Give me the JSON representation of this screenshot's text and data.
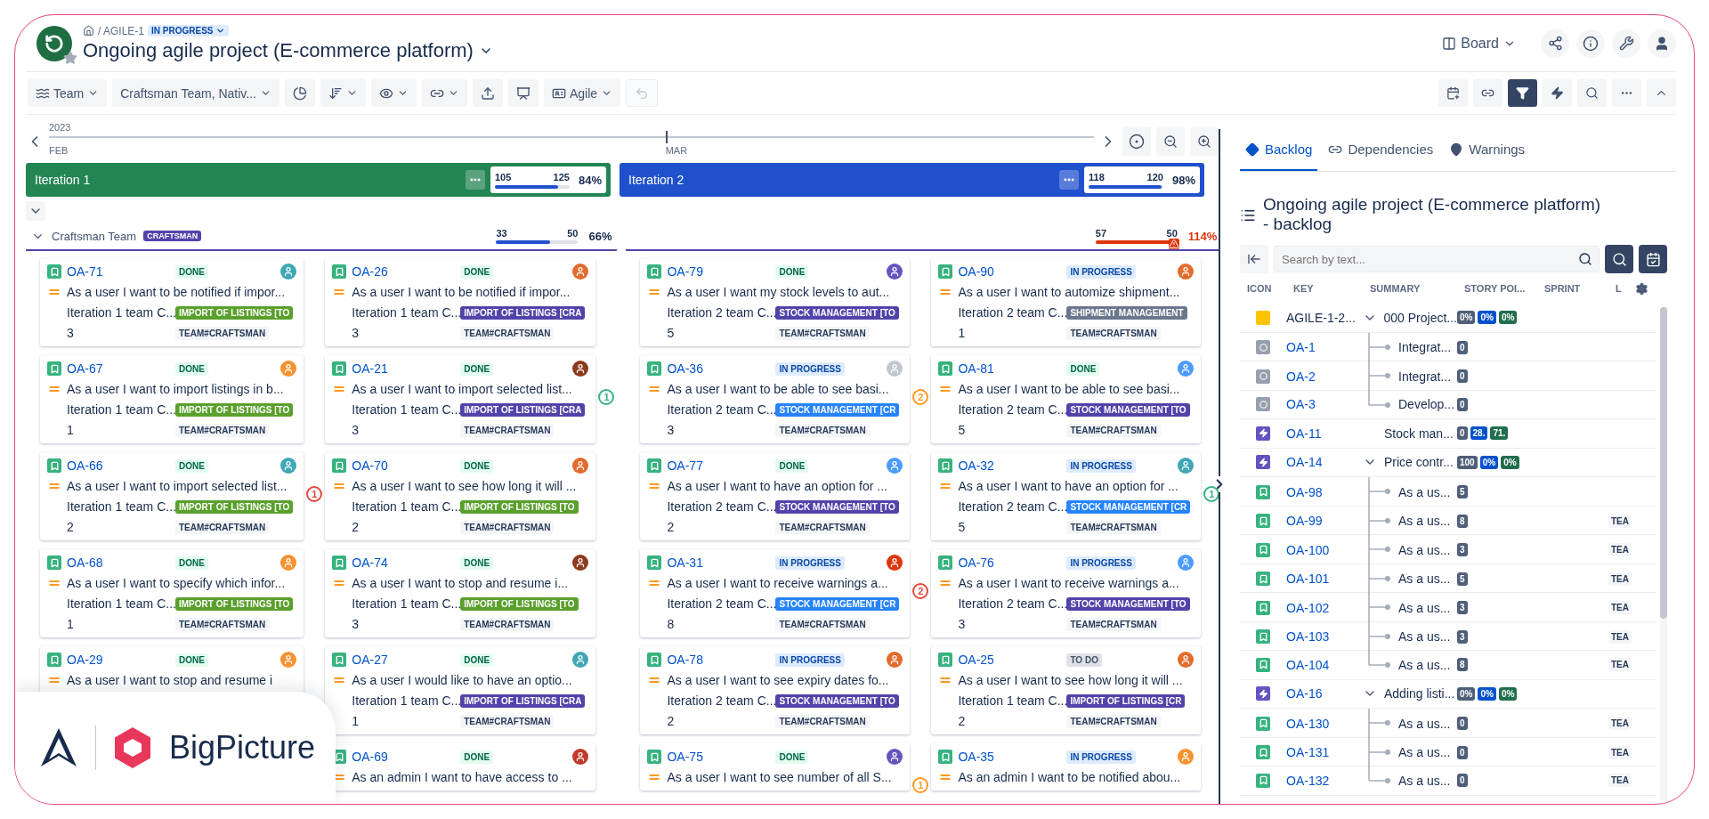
{
  "header": {
    "breadcrumb": "/ AGILE-1",
    "status": "IN PROGRESS",
    "title": "Ongoing agile project (E-commerce platform)",
    "view": "Board"
  },
  "toolbar": {
    "left": [
      {
        "kind": "dropdown",
        "label": "Team",
        "disabled": false
      },
      {
        "kind": "dropdown",
        "label": "Craftsman Team, Nativ...",
        "disabled": false
      },
      {
        "kind": "button",
        "disabled": false
      },
      {
        "kind": "dropdown",
        "disabled": false
      },
      {
        "kind": "dropdown",
        "disabled": false
      },
      {
        "kind": "dropdown",
        "disabled": false
      },
      {
        "kind": "button",
        "disabled": false
      },
      {
        "kind": "button",
        "disabled": false
      },
      {
        "kind": "dropdown",
        "label": "Agile",
        "disabled": false
      },
      {
        "kind": "button",
        "disabled": true
      }
    ],
    "right": [
      {
        "active": false
      },
      {
        "active": false
      },
      {
        "active": true
      },
      {
        "active": false
      },
      {
        "active": false
      },
      {
        "active": false
      },
      {
        "active": false
      }
    ]
  },
  "timeline": {
    "year": "2023",
    "months": [
      "FEB",
      "MAR"
    ]
  },
  "team": {
    "name": "Craftsman Team",
    "tag": "CRAFTSMAN"
  },
  "iterations": [
    {
      "name": "Iteration 1",
      "color": "#238553",
      "committed": "105",
      "capacity": "125",
      "percent": "84%",
      "level": 0.84,
      "team_load": {
        "committed": "33",
        "capacity": "50",
        "percent": "66%",
        "level": 0.66,
        "over": false
      },
      "columns": [
        [
          {
            "key": "OA-71",
            "status": {
              "text": "DONE",
              "kind": "done"
            },
            "avatar": {
              "color": "#3fa7b5"
            },
            "summary": "As a user I want to be notified if impor...",
            "iteration": "Iteration 1 team C...",
            "tag": {
              "text": "IMPORT OF LISTINGS [TO",
              "color": "#5aa02c"
            },
            "points": "3",
            "team": "TEAM#CRAFTSMAN"
          },
          {
            "key": "OA-67",
            "status": {
              "text": "DONE",
              "kind": "done"
            },
            "avatar": {
              "color": "#f79232"
            },
            "summary": "As a user I want to import listings in b...",
            "iteration": "Iteration 1 team C...",
            "tag": {
              "text": "IMPORT OF LISTINGS [TO",
              "color": "#5aa02c"
            },
            "points": "1",
            "team": "TEAM#CRAFTSMAN"
          },
          {
            "key": "OA-66",
            "status": {
              "text": "DONE",
              "kind": "done"
            },
            "avatar": {
              "color": "#3fa7b5"
            },
            "summary": "As a user I want to import selected list...",
            "iteration": "Iteration 1 team C...",
            "tag": {
              "text": "IMPORT OF LISTINGS [TO",
              "color": "#5aa02c"
            },
            "points": "2",
            "team": "TEAM#CRAFTSMAN",
            "count": {
              "text": "1",
              "color": "#e5493a"
            }
          },
          {
            "key": "OA-68",
            "status": {
              "text": "DONE",
              "kind": "done"
            },
            "avatar": {
              "color": "#f79232"
            },
            "summary": "As a user I want to specify which infor...",
            "iteration": "Iteration 1 team C...",
            "tag": {
              "text": "IMPORT OF LISTINGS [TO",
              "color": "#5aa02c"
            },
            "points": "1",
            "team": "TEAM#CRAFTSMAN"
          },
          {
            "key": "OA-29",
            "status": {
              "text": "DONE",
              "kind": "done"
            },
            "avatar": {
              "color": "#f79232"
            },
            "summary": "As a user I want to stop and resume i"
          }
        ],
        [
          {
            "key": "OA-26",
            "status": {
              "text": "DONE",
              "kind": "done"
            },
            "avatar": {
              "color": "#e36b2c"
            },
            "summary": "As a user I want to be notified if impor...",
            "iteration": "Iteration 1 team C...",
            "tag": {
              "text": "IMPORT OF LISTINGS [CRA",
              "color": "#5243aa"
            },
            "points": "3",
            "team": "TEAM#CRAFTSMAN"
          },
          {
            "key": "OA-21",
            "status": {
              "text": "DONE",
              "kind": "done"
            },
            "avatar": {
              "color": "#8c3b1e"
            },
            "summary": "As a user I want to import selected list...",
            "iteration": "Iteration 1 team C...",
            "tag": {
              "text": "IMPORT OF LISTINGS [CRA",
              "color": "#5243aa"
            },
            "points": "3",
            "team": "TEAM#CRAFTSMAN",
            "count": {
              "text": "1",
              "color": "#36b37e"
            }
          },
          {
            "key": "OA-70",
            "status": {
              "text": "DONE",
              "kind": "done"
            },
            "avatar": {
              "color": "#e36b2c"
            },
            "summary": "As a user I want to see how long it will ...",
            "iteration": "Iteration 1 team C...",
            "tag": {
              "text": "IMPORT OF LISTINGS [TO",
              "color": "#5aa02c"
            },
            "points": "2",
            "team": "TEAM#CRAFTSMAN"
          },
          {
            "key": "OA-74",
            "status": {
              "text": "DONE",
              "kind": "done"
            },
            "avatar": {
              "color": "#8c3b1e"
            },
            "summary": "As a user I want to stop and resume i...",
            "iteration": "Iteration 1 team C...",
            "tag": {
              "text": "IMPORT OF LISTINGS [TO",
              "color": "#5aa02c"
            },
            "points": "3",
            "team": "TEAM#CRAFTSMAN"
          },
          {
            "key": "OA-27",
            "status": {
              "text": "DONE",
              "kind": "done"
            },
            "avatar": {
              "color": "#3fa7b5"
            },
            "summary": "As a user I would like to have an optio...",
            "iteration": "Iteration 1 team C...",
            "tag": {
              "text": "IMPORT OF LISTINGS [CRA",
              "color": "#5243aa"
            },
            "points": "1",
            "team": "TEAM#CRAFTSMAN"
          },
          {
            "key": "OA-69",
            "status": {
              "text": "DONE",
              "kind": "done"
            },
            "avatar": {
              "color": "#c0392b"
            },
            "summary": "As an admin I want to have access to ..."
          }
        ]
      ]
    },
    {
      "name": "Iteration 2",
      "color": "#2051cc",
      "committed": "118",
      "capacity": "120",
      "percent": "98%",
      "level": 0.98,
      "team_load": {
        "committed": "57",
        "capacity": "50",
        "percent": "114%",
        "level": 1,
        "over": true
      },
      "columns": [
        [
          {
            "key": "OA-79",
            "status": {
              "text": "DONE",
              "kind": "done"
            },
            "avatar": {
              "color": "#6554c0"
            },
            "summary": "As a user I want my stock levels to aut...",
            "iteration": "Iteration 2 team C...",
            "tag": {
              "text": "STOCK MANAGEMENT [TO",
              "color": "#5243aa"
            },
            "points": "5",
            "team": "TEAM#CRAFTSMAN"
          },
          {
            "key": "OA-36",
            "status": {
              "text": "IN PROGRESS",
              "kind": "in_progress"
            },
            "avatar": {
              "color": "#c1c7d0"
            },
            "summary": "As a user I want to be able to see basi...",
            "iteration": "Iteration 2 team C...",
            "tag": {
              "text": "STOCK MANAGEMENT [CR",
              "color": "#2684ff"
            },
            "points": "3",
            "team": "TEAM#CRAFTSMAN",
            "count": {
              "text": "2",
              "color": "#ff991f"
            }
          },
          {
            "key": "OA-77",
            "status": {
              "text": "DONE",
              "kind": "done"
            },
            "avatar": {
              "color": "#4c9aff"
            },
            "summary": "As a user I want to have an option for ...",
            "iteration": "Iteration 2 team C...",
            "tag": {
              "text": "STOCK MANAGEMENT [TO",
              "color": "#5243aa"
            },
            "points": "2",
            "team": "TEAM#CRAFTSMAN"
          },
          {
            "key": "OA-31",
            "status": {
              "text": "IN PROGRESS",
              "kind": "in_progress"
            },
            "avatar": {
              "color": "#de350b"
            },
            "summary": "As a user I want to receive warnings a...",
            "iteration": "Iteration 2 team C...",
            "tag": {
              "text": "STOCK MANAGEMENT [CR",
              "color": "#2684ff"
            },
            "points": "8",
            "team": "TEAM#CRAFTSMAN",
            "count": {
              "text": "2",
              "color": "#e5493a"
            }
          },
          {
            "key": "OA-78",
            "status": {
              "text": "IN PROGRESS",
              "kind": "in_progress"
            },
            "avatar": {
              "color": "#e36b2c"
            },
            "summary": "As a user I want to see expiry dates fo...",
            "iteration": "Iteration 2 team C...",
            "tag": {
              "text": "STOCK MANAGEMENT [TO",
              "color": "#5243aa"
            },
            "points": "2",
            "team": "TEAM#CRAFTSMAN"
          },
          {
            "key": "OA-75",
            "status": {
              "text": "DONE",
              "kind": "done"
            },
            "avatar": {
              "color": "#6554c0"
            },
            "summary": "As a user I want to see number of all S...",
            "count": {
              "text": "1",
              "color": "#ff991f"
            }
          }
        ],
        [
          {
            "key": "OA-90",
            "status": {
              "text": "IN PROGRESS",
              "kind": "in_progress"
            },
            "avatar": {
              "color": "#e36b2c"
            },
            "summary": "As a user I want to automize shipment...",
            "iteration": "Iteration 2 team C...",
            "tag": {
              "text": "SHIPMENT MANAGEMENT",
              "color": "#6b778c"
            },
            "points": "1",
            "team": "TEAM#CRAFTSMAN"
          },
          {
            "key": "OA-81",
            "status": {
              "text": "DONE",
              "kind": "done"
            },
            "avatar": {
              "color": "#4c9aff"
            },
            "summary": "As a user I want to be able to see basi...",
            "iteration": "Iteration 2 team C...",
            "tag": {
              "text": "STOCK MANAGEMENT [TO",
              "color": "#5243aa"
            },
            "points": "5",
            "team": "TEAM#CRAFTSMAN"
          },
          {
            "key": "OA-32",
            "status": {
              "text": "IN PROGRESS",
              "kind": "in_progress"
            },
            "avatar": {
              "color": "#3fa7b5"
            },
            "summary": "As a user I want to have an option for ...",
            "iteration": "Iteration 2 team C...",
            "tag": {
              "text": "STOCK MANAGEMENT [CR",
              "color": "#2684ff"
            },
            "points": "5",
            "team": "TEAM#CRAFTSMAN",
            "count": {
              "text": "1",
              "color": "#36b37e"
            }
          },
          {
            "key": "OA-76",
            "status": {
              "text": "IN PROGRESS",
              "kind": "in_progress"
            },
            "avatar": {
              "color": "#4c9aff"
            },
            "summary": "As a user I want to receive warnings a...",
            "iteration": "Iteration 2 team C...",
            "tag": {
              "text": "STOCK MANAGEMENT [TO",
              "color": "#5243aa"
            },
            "points": "3",
            "team": "TEAM#CRAFTSMAN"
          },
          {
            "key": "OA-25",
            "status": {
              "text": "TO DO",
              "kind": "todo"
            },
            "avatar": {
              "color": "#e36b2c"
            },
            "summary": "As a user I want to see how long it will ...",
            "iteration": "Iteration 1 team C...",
            "tag": {
              "text": "IMPORT OF LISTINGS [CR",
              "color": "#5243aa"
            },
            "points": "2",
            "team": "TEAM#CRAFTSMAN"
          },
          {
            "key": "OA-35",
            "status": {
              "text": "IN PROGRESS",
              "kind": "in_progress"
            },
            "avatar": {
              "color": "#f79232"
            },
            "summary": "As an admin I want to be notified abou..."
          }
        ]
      ]
    }
  ],
  "backlog": {
    "tabs": [
      {
        "label": "Backlog",
        "selected": true
      },
      {
        "label": "Dependencies",
        "selected": false
      },
      {
        "label": "Warnings",
        "selected": false
      }
    ],
    "title": "Ongoing agile project (E-commerce platform) - backlog",
    "search": {
      "placeholder": "Search by text..."
    },
    "columns": [
      "ICON",
      "KEY",
      "SUMMARY",
      "STORY POI...",
      "SPRINT",
      "L"
    ],
    "rows": [
      {
        "kind": "group",
        "key": "AGILE-1-2...",
        "summary": "000 Project...",
        "points": [
          "0%",
          "0%",
          "0%"
        ],
        "expanded": true,
        "children": [
          {
            "kind": "task",
            "key": "OA-1",
            "summary": "Integrat...",
            "points": [
              "0"
            ]
          },
          {
            "kind": "task",
            "key": "OA-2",
            "summary": "Integrat...",
            "points": [
              "0"
            ]
          },
          {
            "kind": "task",
            "key": "OA-3",
            "summary": "Develop...",
            "points": [
              "0"
            ]
          }
        ]
      },
      {
        "kind": "epic",
        "key": "OA-11",
        "summary": "Stock man...",
        "points": [
          "0",
          "28.",
          "71."
        ]
      },
      {
        "kind": "epic",
        "key": "OA-14",
        "summary": "Price contr...",
        "points": [
          "100",
          "0%",
          "0%"
        ],
        "expanded": true,
        "children": [
          {
            "kind": "story",
            "key": "OA-98",
            "summary": "As a us...",
            "points": [
              "5"
            ]
          },
          {
            "kind": "story",
            "key": "OA-99",
            "summary": "As a us...",
            "points": [
              "8"
            ],
            "team": "TEA"
          },
          {
            "kind": "story",
            "key": "OA-100",
            "summary": "As a us...",
            "points": [
              "3"
            ],
            "team": "TEA"
          },
          {
            "kind": "story",
            "key": "OA-101",
            "summary": "As a us...",
            "points": [
              "5"
            ],
            "team": "TEA"
          },
          {
            "kind": "story",
            "key": "OA-102",
            "summary": "As a us...",
            "points": [
              "3"
            ],
            "team": "TEA"
          },
          {
            "kind": "story",
            "key": "OA-103",
            "summary": "As a us...",
            "points": [
              "3"
            ],
            "team": "TEA"
          },
          {
            "kind": "story",
            "key": "OA-104",
            "summary": "As a us...",
            "points": [
              "8"
            ],
            "team": "TEA"
          }
        ]
      },
      {
        "kind": "epic",
        "key": "OA-16",
        "summary": "Adding listi...",
        "points": [
          "0%",
          "0%",
          "0%"
        ],
        "expanded": true,
        "children": [
          {
            "kind": "story",
            "key": "OA-130",
            "summary": "As a us...",
            "points": [
              "0"
            ],
            "team": "TEA"
          },
          {
            "kind": "story",
            "key": "OA-131",
            "summary": "As a us...",
            "points": [
              "0"
            ],
            "team": "TEA"
          },
          {
            "kind": "story",
            "key": "OA-132",
            "summary": "As a us...",
            "points": [
              "0"
            ],
            "team": "TEA"
          }
        ]
      }
    ]
  },
  "brand_badge": {
    "name": "BigPicture"
  }
}
